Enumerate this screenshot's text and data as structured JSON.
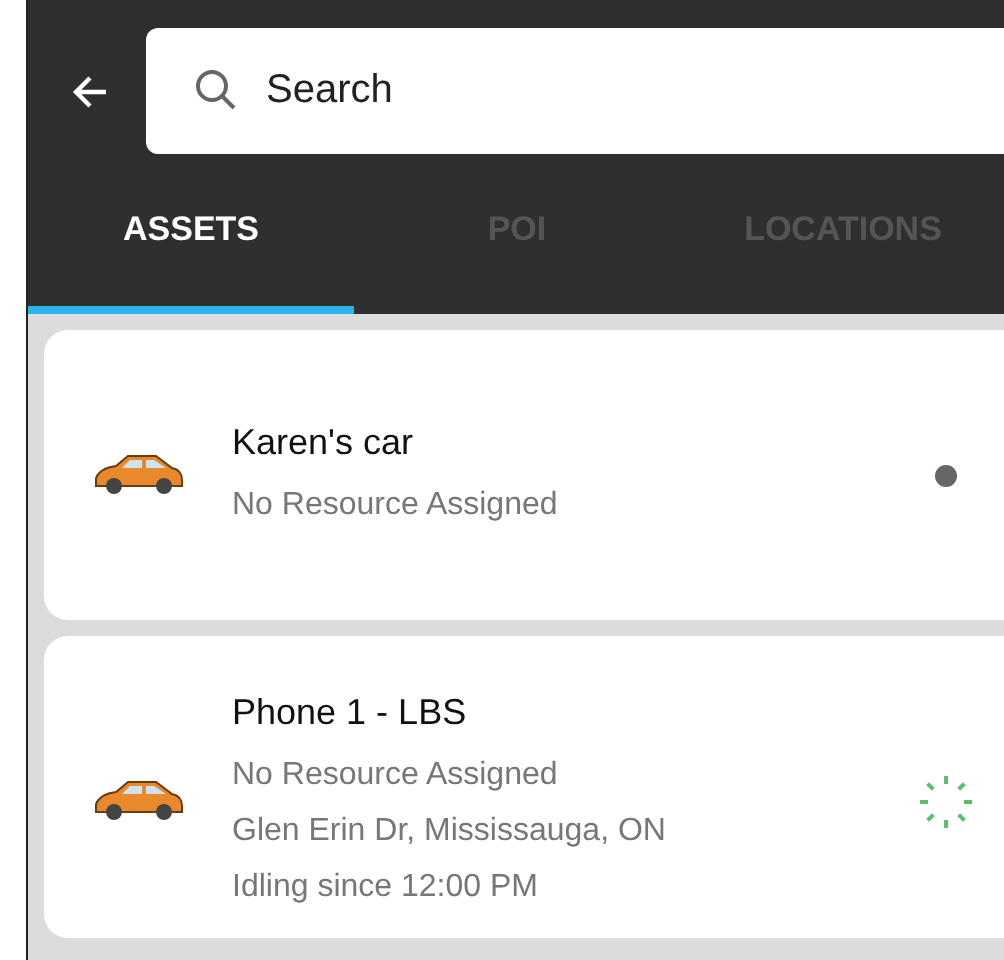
{
  "search": {
    "placeholder": "Search"
  },
  "tabs": [
    {
      "label": "ASSETS",
      "selected": true
    },
    {
      "label": "POI",
      "selected": false
    },
    {
      "label": "LOCATIONS",
      "selected": false
    }
  ],
  "assets": [
    {
      "name": "Karen's car",
      "details": [
        "No Resource Assigned"
      ],
      "status": {
        "kind": "dot",
        "color": "#666666"
      }
    },
    {
      "name": "Phone 1 - LBS",
      "details": [
        "No Resource Assigned",
        "Glen Erin Dr, Mississauga, ON",
        "Idling since 12:00 PM"
      ],
      "status": {
        "kind": "spinner",
        "color": "#5cbf6a"
      }
    }
  ]
}
